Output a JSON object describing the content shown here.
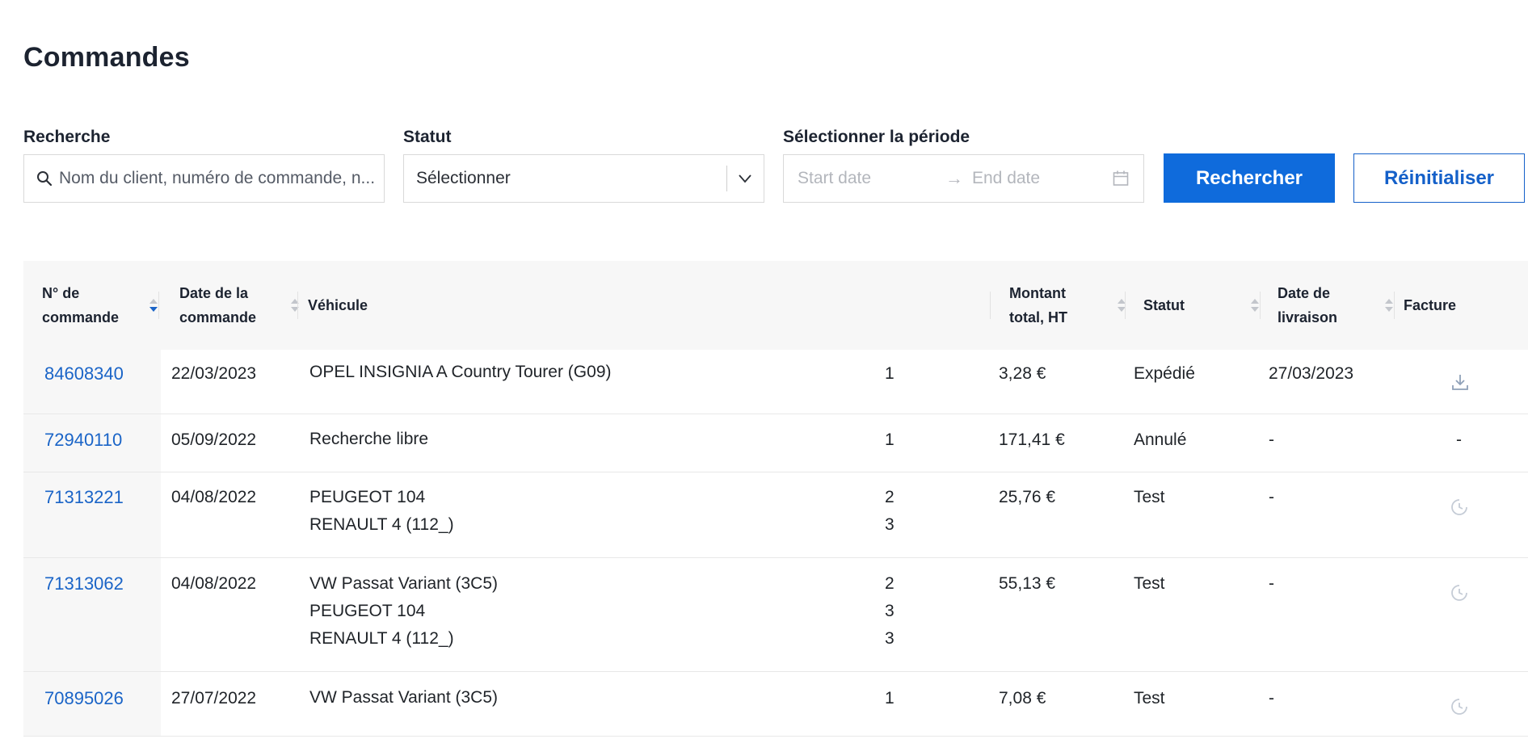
{
  "page": {
    "title": "Commandes"
  },
  "filters": {
    "search": {
      "label": "Recherche",
      "placeholder": "Nom du client, numéro de commande, n..."
    },
    "status": {
      "label": "Statut",
      "value": "Sélectionner"
    },
    "period": {
      "label": "Sélectionner la période",
      "start_placeholder": "Start date",
      "arrow": "→",
      "end_placeholder": "End date"
    },
    "search_button": "Rechercher",
    "reset_button": "Réinitialiser"
  },
  "table": {
    "headers": {
      "order_no_1": "N° de",
      "order_no_2": "commande",
      "date_1": "Date de la",
      "date_2": "commande",
      "vehicle": "Véhicule",
      "amount_1": "Montant",
      "amount_2": "total, HT",
      "status": "Statut",
      "delivery_1": "Date de",
      "delivery_2": "livraison",
      "invoice": "Facture"
    },
    "rows": [
      {
        "order": "84608340",
        "date": "22/03/2023",
        "vehicles": [
          "OPEL INSIGNIA A Country Tourer (G09)"
        ],
        "quantities": [
          "1"
        ],
        "amount": "3,28 €",
        "status": "Expédié",
        "delivery": "27/03/2023",
        "invoice": "download-icon"
      },
      {
        "order": "72940110",
        "date": "05/09/2022",
        "vehicles": [
          "Recherche libre"
        ],
        "quantities": [
          "1"
        ],
        "amount": "171,41 €",
        "status": "Annulé",
        "delivery": "-",
        "invoice": "-"
      },
      {
        "order": "71313221",
        "date": "04/08/2022",
        "vehicles": [
          "PEUGEOT 104",
          "RENAULT 4 (112_)"
        ],
        "quantities": [
          "2",
          "3"
        ],
        "amount": "25,76 €",
        "status": "Test",
        "delivery": "-",
        "invoice": "pending-clock-icon"
      },
      {
        "order": "71313062",
        "date": "04/08/2022",
        "vehicles": [
          "VW Passat Variant (3C5)",
          "PEUGEOT 104",
          "RENAULT 4 (112_)"
        ],
        "quantities": [
          "2",
          "3",
          "3"
        ],
        "amount": "55,13 €",
        "status": "Test",
        "delivery": "-",
        "invoice": "pending-clock-icon"
      },
      {
        "order": "70895026",
        "date": "27/07/2022",
        "vehicles": [
          "VW Passat Variant (3C5)"
        ],
        "quantities": [
          "1"
        ],
        "amount": "7,08 €",
        "status": "Test",
        "delivery": "-",
        "invoice": "pending-clock-icon"
      }
    ]
  },
  "colors": {
    "primary": "#0f6bdc",
    "link": "#1a64c7",
    "header_bg": "#f7f7f7",
    "active_sort": "#1a64c7"
  }
}
